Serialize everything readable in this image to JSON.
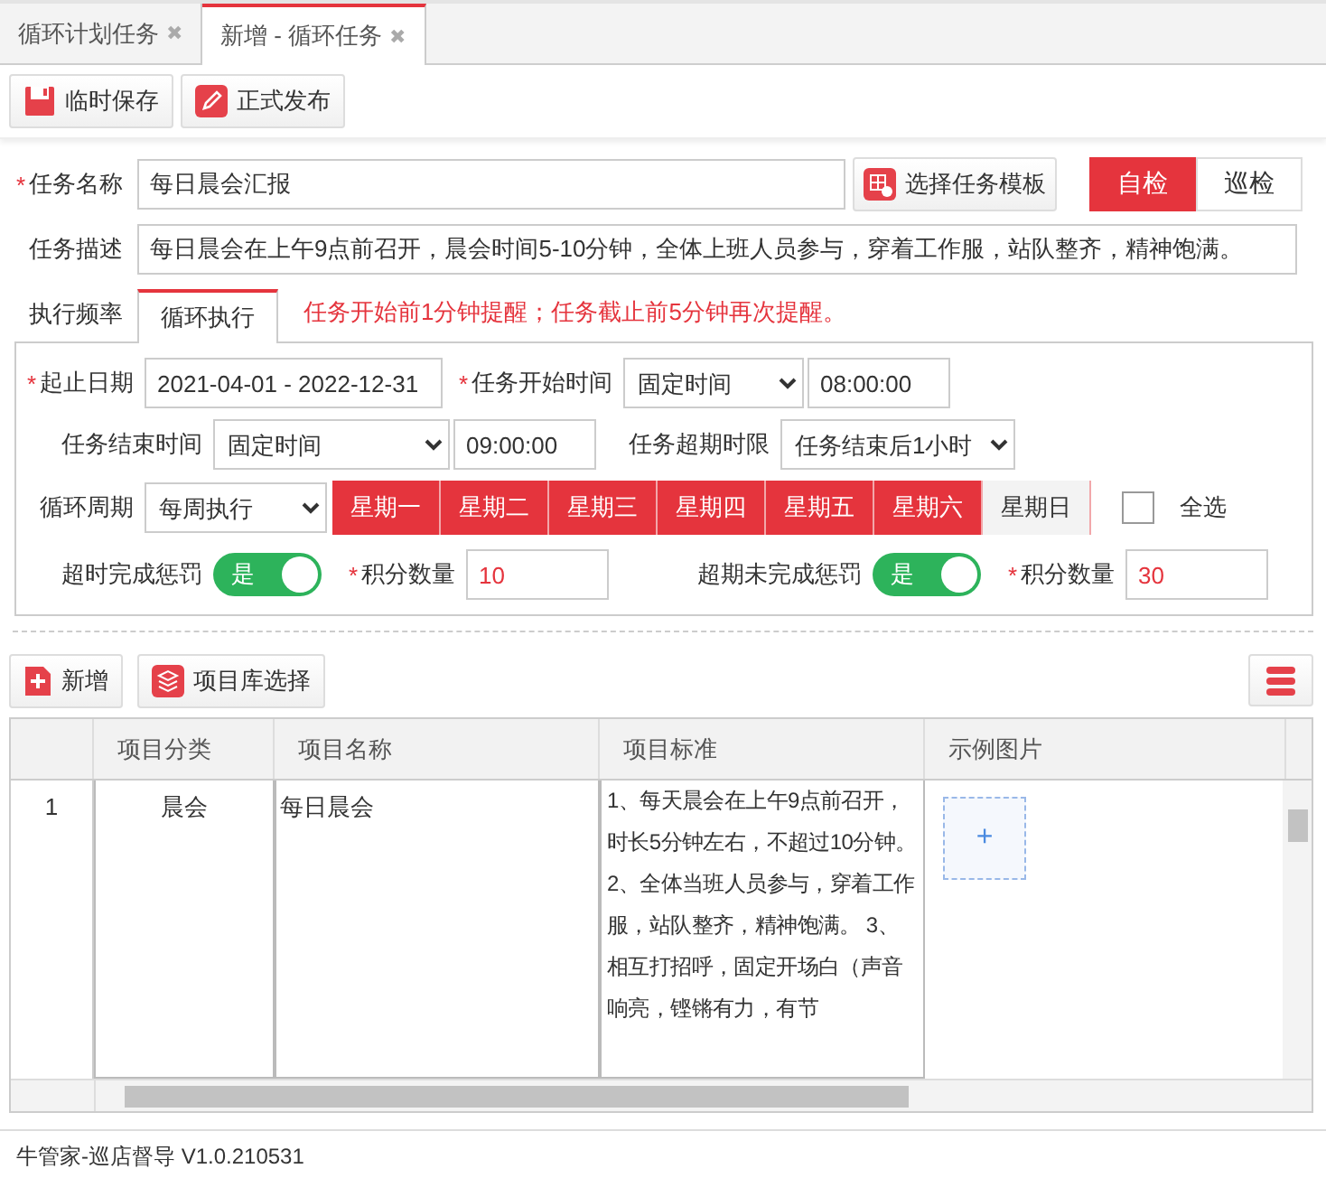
{
  "tabs": [
    {
      "label": "循环计划任务",
      "selected": false,
      "close": "✖"
    },
    {
      "label": "新增 - 循环任务",
      "selected": true,
      "close": "✖"
    }
  ],
  "toolbar": [
    {
      "label": "临时保存",
      "kind": "save"
    },
    {
      "label": "正式发布",
      "kind": "publish"
    }
  ],
  "task_name": {
    "label": "任务名称",
    "required_mark": "*",
    "value": "每日晨会汇报"
  },
  "template_button": "选择任务模板",
  "check_type": [
    {
      "label": "自检",
      "selected": true
    },
    {
      "label": "巡检",
      "selected": false
    }
  ],
  "task_desc": {
    "label": "任务描述",
    "value": "每日晨会在上午9点前召开，晨会时间5-10分钟，全体上班人员参与，穿着工作服，站队整齐，精神饱满。"
  },
  "freq_label": "执行频率",
  "freq_tab": "循环执行",
  "reminder": "任务开始前1分钟提醒；任务截止前5分钟再次提醒。",
  "date_range": {
    "label": "起止日期",
    "required_mark": "*",
    "value": "2021-04-01 - 2022-12-31"
  },
  "start_time": {
    "label": "任务开始时间",
    "required_mark": "*",
    "mode": "固定时间",
    "value": "08:00:00"
  },
  "end_time": {
    "label": "任务结束时间",
    "mode": "固定时间",
    "value": "09:00:00"
  },
  "overdue_limit": {
    "label": "任务超期时限",
    "value": "任务结束后1小时"
  },
  "cycle": {
    "label": "循环周期",
    "mode": "每周执行",
    "days": [
      {
        "label": "星期一",
        "selected": true
      },
      {
        "label": "星期二",
        "selected": true
      },
      {
        "label": "星期三",
        "selected": true
      },
      {
        "label": "星期四",
        "selected": true
      },
      {
        "label": "星期五",
        "selected": true
      },
      {
        "label": "星期六",
        "selected": true
      },
      {
        "label": "星期日",
        "selected": false
      }
    ],
    "select_all": {
      "label": "全选",
      "checked": false
    }
  },
  "penalties": [
    {
      "label": "超时完成惩罚",
      "toggle": "是",
      "on": true,
      "points_mark": "*",
      "points_label": "积分数量",
      "points": "10"
    },
    {
      "label": "超期未完成惩罚",
      "toggle": "是",
      "on": true,
      "points_mark": "*",
      "points_label": "积分数量",
      "points": "30"
    }
  ],
  "items_toolbar": [
    {
      "label": "新增",
      "kind": "add"
    },
    {
      "label": "项目库选择",
      "kind": "library"
    }
  ],
  "table": {
    "columns": [
      "项目分类",
      "项目名称",
      "项目标准",
      "示例图片"
    ],
    "rows": [
      {
        "index": "1",
        "category": "晨会",
        "name": "每日晨会",
        "standard": "1、每天晨会在上午9点前召开，时长5分钟左右，不超过10分钟。 2、全体当班人员参与，穿着工作服，站队整齐，精神饱满。 3、相互打招呼，固定开场白（声音响亮，铿锵有力，有节",
        "image_add": "+"
      }
    ]
  },
  "status_bar": "牛管家-巡店督导 V1.0.210531"
}
